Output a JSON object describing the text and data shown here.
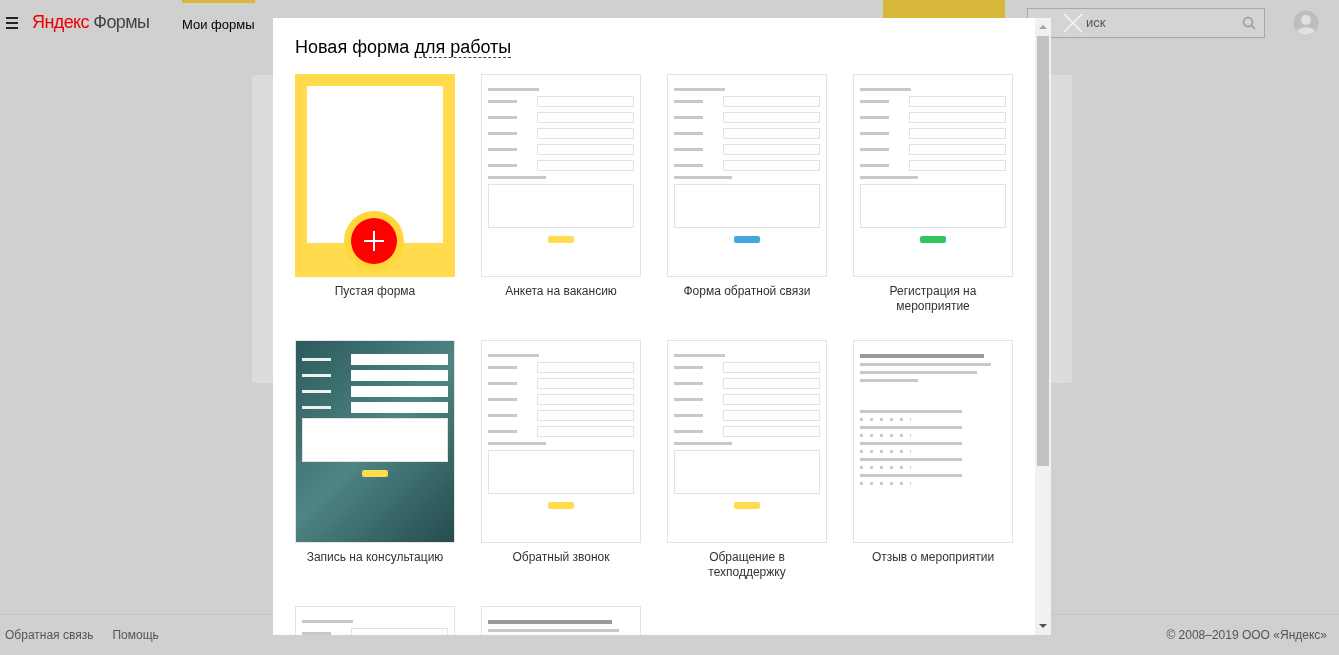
{
  "header": {
    "logo": {
      "brand": "Яндекс",
      "product": "Формы"
    },
    "tabs": [
      {
        "label": "Мои формы",
        "selected": true
      }
    ],
    "search": {
      "placeholder": "иск"
    }
  },
  "dialog": {
    "title": "Новая форма",
    "title_link": "для работы",
    "templates": [
      {
        "kind": "blank",
        "title": "Пустая форма"
      },
      {
        "kind": "form",
        "title": "Анкета на вакансию",
        "color": "#ffdb4d"
      },
      {
        "kind": "form",
        "title": "Форма обратной связи",
        "color": "#43a8e0"
      },
      {
        "kind": "form",
        "title": "Регистрация на мероприятие",
        "color": "#2fc65f"
      },
      {
        "kind": "photo",
        "title": "Запись на консультацию",
        "color": "#ffdb4d"
      },
      {
        "kind": "form",
        "title": "Обратный звонок",
        "color": "#ffdb4d"
      },
      {
        "kind": "form",
        "title": "Обращение в техподдержку",
        "color": "#ffdb4d"
      },
      {
        "kind": "survey",
        "title": "Отзыв о мероприятии"
      },
      {
        "kind": "form"
      },
      {
        "kind": "survey"
      }
    ]
  },
  "footer": {
    "links": [
      "Обратная связь",
      "Помощь"
    ],
    "copyright": "© 2008–2019 ООО «Яндекс»"
  }
}
